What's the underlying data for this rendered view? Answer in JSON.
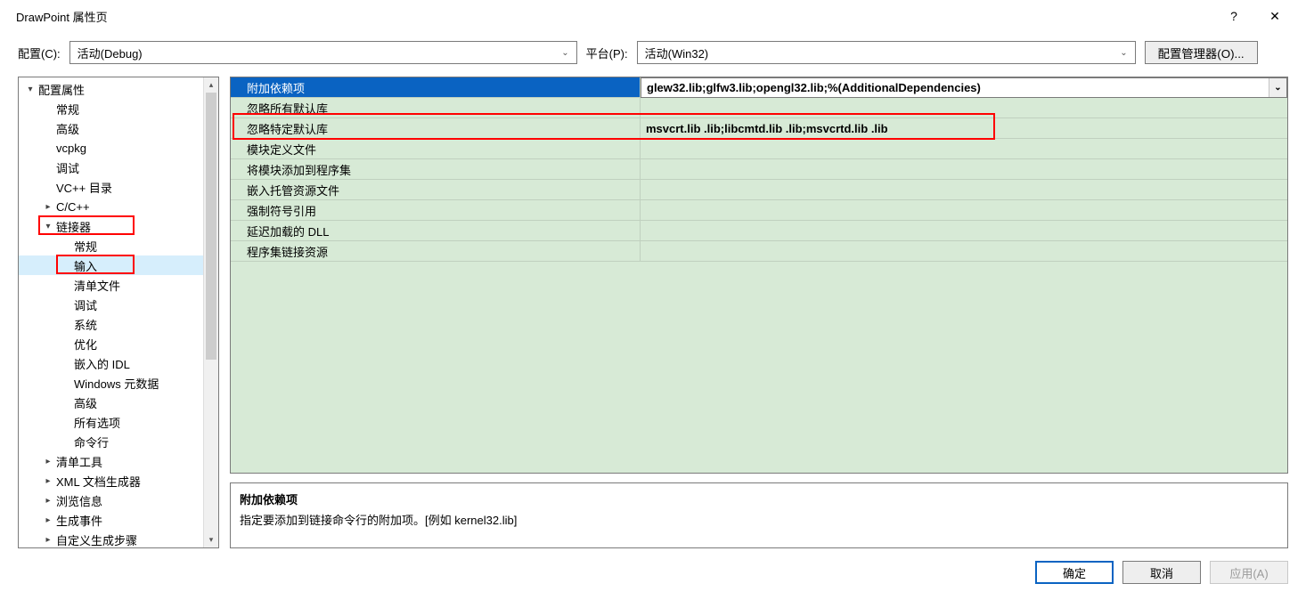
{
  "window": {
    "title": "DrawPoint 属性页",
    "help": "?",
    "close": "✕"
  },
  "toolbar": {
    "config_label": "配置(C):",
    "config_value": "活动(Debug)",
    "platform_label": "平台(P):",
    "platform_value": "活动(Win32)",
    "config_manager": "配置管理器(O)..."
  },
  "tree": [
    {
      "label": "配置属性",
      "depth": 0,
      "exp": "▾"
    },
    {
      "label": "常规",
      "depth": 1,
      "leaf": true
    },
    {
      "label": "高级",
      "depth": 1,
      "leaf": true
    },
    {
      "label": "vcpkg",
      "depth": 1,
      "leaf": true
    },
    {
      "label": "调试",
      "depth": 1,
      "leaf": true
    },
    {
      "label": "VC++ 目录",
      "depth": 1,
      "leaf": true
    },
    {
      "label": "C/C++",
      "depth": 1,
      "exp": "▸"
    },
    {
      "label": "链接器",
      "depth": 1,
      "exp": "▾",
      "hi": true
    },
    {
      "label": "常规",
      "depth": 2,
      "leaf": true
    },
    {
      "label": "输入",
      "depth": 2,
      "leaf": true,
      "sel": true,
      "hi": true
    },
    {
      "label": "清单文件",
      "depth": 2,
      "leaf": true
    },
    {
      "label": "调试",
      "depth": 2,
      "leaf": true
    },
    {
      "label": "系统",
      "depth": 2,
      "leaf": true
    },
    {
      "label": "优化",
      "depth": 2,
      "leaf": true
    },
    {
      "label": "嵌入的 IDL",
      "depth": 2,
      "leaf": true
    },
    {
      "label": "Windows 元数据",
      "depth": 2,
      "leaf": true
    },
    {
      "label": "高级",
      "depth": 2,
      "leaf": true
    },
    {
      "label": "所有选项",
      "depth": 2,
      "leaf": true
    },
    {
      "label": "命令行",
      "depth": 2,
      "leaf": true
    },
    {
      "label": "清单工具",
      "depth": 1,
      "exp": "▸"
    },
    {
      "label": "XML 文档生成器",
      "depth": 1,
      "exp": "▸"
    },
    {
      "label": "浏览信息",
      "depth": 1,
      "exp": "▸"
    },
    {
      "label": "生成事件",
      "depth": 1,
      "exp": "▸"
    },
    {
      "label": "自定义生成步骤",
      "depth": 1,
      "exp": "▸"
    }
  ],
  "grid": [
    {
      "name": "附加依赖项",
      "value": "glew32.lib;glfw3.lib;opengl32.lib;%(AdditionalDependencies)",
      "sel": true
    },
    {
      "name": "忽略所有默认库",
      "value": ""
    },
    {
      "name": "忽略特定默认库",
      "value": "msvcrt.lib .lib;libcmtd.lib .lib;msvcrtd.lib .lib",
      "hi": true
    },
    {
      "name": "模块定义文件",
      "value": ""
    },
    {
      "name": "将模块添加到程序集",
      "value": ""
    },
    {
      "name": "嵌入托管资源文件",
      "value": ""
    },
    {
      "name": "强制符号引用",
      "value": ""
    },
    {
      "name": "延迟加载的 DLL",
      "value": ""
    },
    {
      "name": "程序集链接资源",
      "value": ""
    }
  ],
  "desc": {
    "title": "附加依赖项",
    "body": "指定要添加到链接命令行的附加项。[例如 kernel32.lib]"
  },
  "footer": {
    "ok": "确定",
    "cancel": "取消",
    "apply": "应用(A)"
  }
}
